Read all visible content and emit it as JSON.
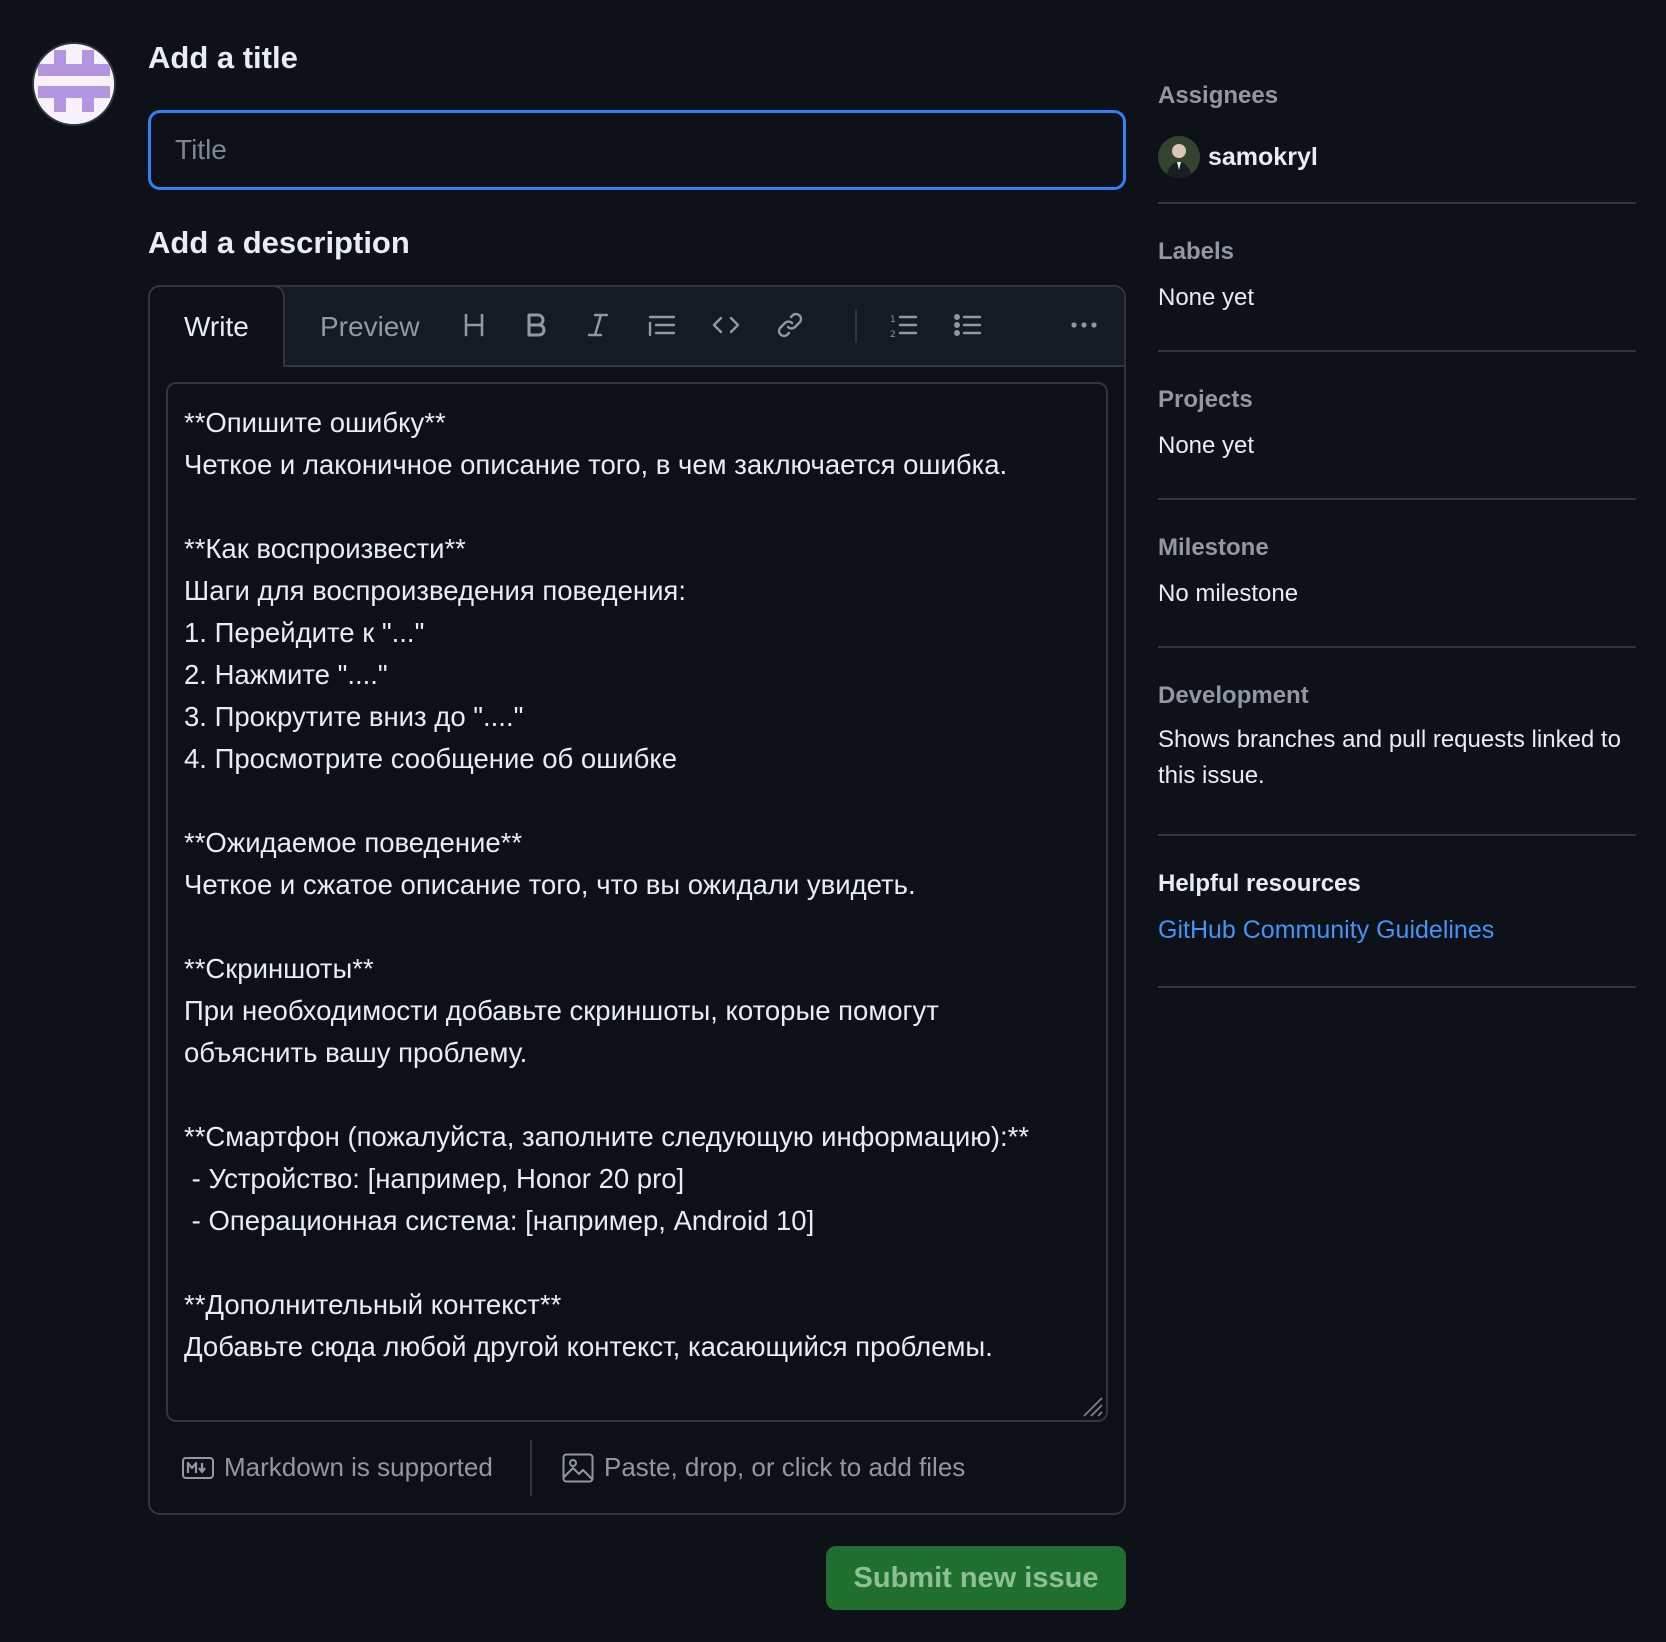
{
  "author": {
    "avatar_name": "identicon avatar"
  },
  "title_section": {
    "heading": "Add a title",
    "placeholder": "Title",
    "value": ""
  },
  "description_section": {
    "heading": "Add a description",
    "tabs": [
      "Write",
      "Preview"
    ],
    "active_tab": "Write",
    "toolbar": [
      "heading",
      "bold",
      "italic",
      "quote",
      "code",
      "link",
      "numbered-list",
      "unordered-list",
      "more"
    ],
    "body": "**Опишите ошибку**\nЧеткое и лаконичное описание того, в чем заключается ошибка.\n\n**Как воспроизвести**\nШаги для воспроизведения поведения:\n1. Перейдите к \"...\"\n2. Нажмите \"....\"\n3. Прокрутите вниз до \"....\"\n4. Просмотрите сообщение об ошибке\n\n**Ожидаемое поведение**\nЧеткое и сжатое описание того, что вы ожидали увидеть.\n\n**Скриншоты**\nПри необходимости добавьте скриншоты, которые помогут\nобъяснить вашу проблему.\n\n**Смартфон (пожалуйста, заполните следующую информацию):**\n - Устройство: [например, Honor 20 pro]\n - Операционная система: [например, Android 10]\n\n**Дополнительный контекст**\nДобавьте сюда любой другой контекст, касающийся проблемы.",
    "markdown_note": "Markdown is supported",
    "attach_note": "Paste, drop, or click to add files"
  },
  "submit_label": "Submit new issue",
  "sidebar": {
    "assignees": {
      "heading": "Assignees",
      "user": "samokryl"
    },
    "labels": {
      "heading": "Labels",
      "value": "None yet"
    },
    "projects": {
      "heading": "Projects",
      "value": "None yet"
    },
    "milestone": {
      "heading": "Milestone",
      "value": "No milestone"
    },
    "development": {
      "heading": "Development",
      "value": "Shows branches and pull requests linked to this issue."
    },
    "resources": {
      "heading": "Helpful resources",
      "link": "GitHub Community Guidelines"
    }
  },
  "colors": {
    "background": "#0e1117",
    "accent": "#2f81f7",
    "link": "#4493f8",
    "submit_bg": "#1f6f2f",
    "avatar_purple": "#b495e0"
  }
}
